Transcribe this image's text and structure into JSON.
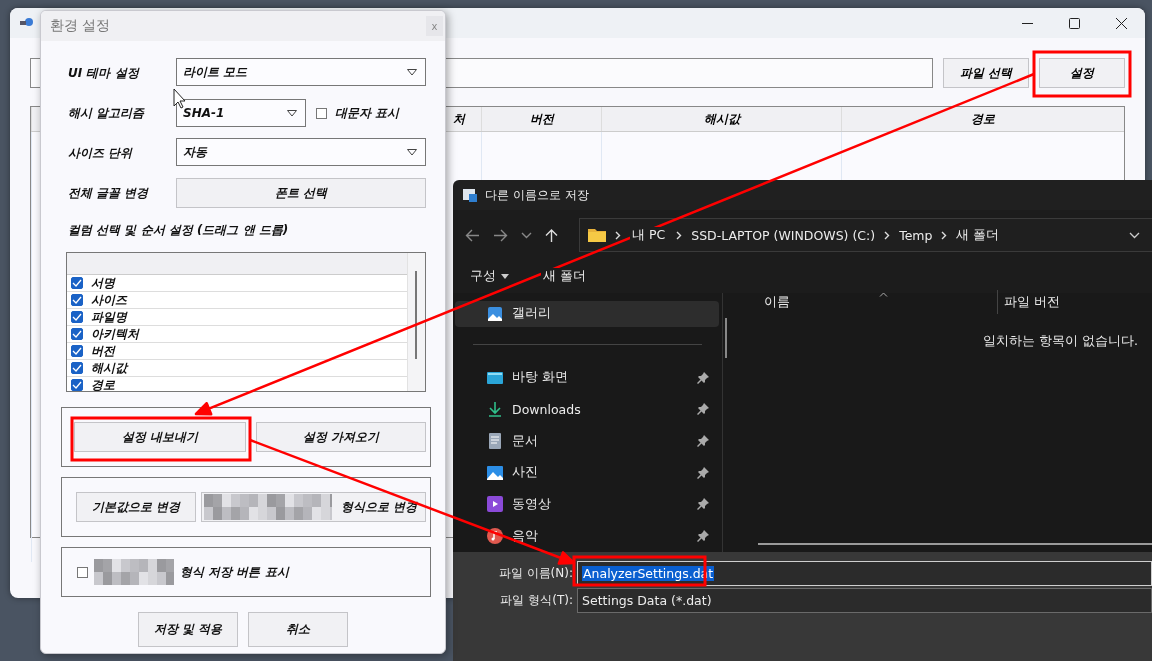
{
  "main_window": {
    "buttons": [
      {
        "label": "파일 선택"
      },
      {
        "label": "설정"
      }
    ],
    "table": {
      "columns": [
        "처",
        "버전",
        "해시값",
        "경로"
      ]
    }
  },
  "settings_dialog": {
    "title": "환경 설정",
    "close": "x",
    "rows": [
      {
        "kind": "combo",
        "label": "UI 테마 설정",
        "value": "라이트 모드"
      },
      {
        "kind": "combo",
        "label": "해시 알고리즘",
        "value": "SHA-1",
        "checkbox": {
          "label": "대문자 표시",
          "checked": false
        }
      },
      {
        "kind": "combo",
        "label": "사이즈 단위",
        "value": "자동"
      },
      {
        "kind": "button",
        "label": "전체 글꼴 변경",
        "value": "폰트 선택"
      }
    ],
    "columns_heading": "컬럼 선택 및 순서 설정 (드래그 앤 드롭)",
    "columns": [
      {
        "label": "서명",
        "checked": true
      },
      {
        "label": "사이즈",
        "checked": true
      },
      {
        "label": "파일명",
        "checked": true
      },
      {
        "label": "아키텍처",
        "checked": true
      },
      {
        "label": "버전",
        "checked": true
      },
      {
        "label": "해시값",
        "checked": true
      },
      {
        "label": "경로",
        "checked": true
      }
    ],
    "export_button": "설정 내보내기",
    "import_button": "설정 가져오기",
    "reset_button": "기본값으로 변경",
    "format_button": "형식으로 변경",
    "format_save_checkbox": {
      "label": "형식 저장 버튼 표시",
      "checked": false
    },
    "save_button": "저장 및 적용",
    "cancel_button": "취소"
  },
  "save_dialog": {
    "title": "다른 이름으로 저장",
    "breadcrumbs": [
      "내 PC",
      "SSD-LAPTOP (WINDOWS) (C:)",
      "Temp",
      "새 폴더"
    ],
    "toolbar": {
      "organize": "구성",
      "new_folder": "새 폴더"
    },
    "nav": [
      {
        "kind": "gallery",
        "label": "갤러리",
        "selected": true,
        "pinned": false
      },
      {
        "kind": "desktop",
        "label": "바탕 화면",
        "selected": false,
        "pinned": true
      },
      {
        "kind": "downloads",
        "label": "Downloads",
        "selected": false,
        "pinned": true
      },
      {
        "kind": "documents",
        "label": "문서",
        "selected": false,
        "pinned": true
      },
      {
        "kind": "pictures",
        "label": "사진",
        "selected": false,
        "pinned": true
      },
      {
        "kind": "videos",
        "label": "동영상",
        "selected": false,
        "pinned": true
      },
      {
        "kind": "music",
        "label": "음악",
        "selected": false,
        "pinned": true
      }
    ],
    "columns": [
      "이름",
      "파일 버전"
    ],
    "empty_message": "일치하는 항목이 없습니다.",
    "file_name": {
      "label": "파일 이름(N):",
      "value": "AnalyzerSettings.dat"
    },
    "file_type": {
      "label": "파일 형식(T):",
      "value": "Settings Data (*.dat)"
    }
  }
}
